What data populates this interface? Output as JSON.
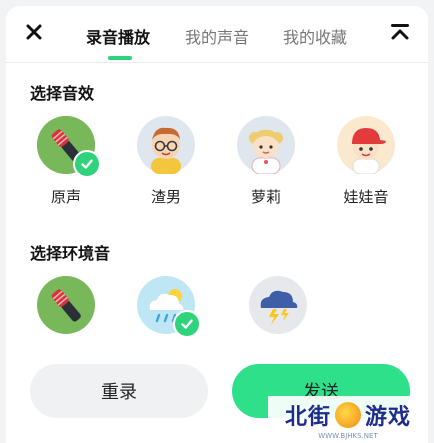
{
  "tabs": [
    "录音播放",
    "我的声音",
    "我的收藏"
  ],
  "active_tab": 0,
  "sections": {
    "effects_title": "选择音效",
    "ambient_title": "选择环境音"
  },
  "effects": [
    {
      "label": "原声",
      "icon": "microphone-icon",
      "selected": true
    },
    {
      "label": "渣男",
      "icon": "glasses-boy-icon",
      "selected": false
    },
    {
      "label": "萝莉",
      "icon": "girl-icon",
      "selected": false
    },
    {
      "label": "娃娃音",
      "icon": "cap-kid-icon",
      "selected": false
    }
  ],
  "ambient": [
    {
      "icon": "microphone-icon",
      "selected": false
    },
    {
      "icon": "rain-cloud-icon",
      "selected": true
    },
    {
      "icon": "thunderstorm-icon",
      "selected": false
    }
  ],
  "buttons": {
    "reset": "重录",
    "send": "发送"
  },
  "watermark": {
    "text_left": "北街",
    "text_right": "游戏",
    "url": "WWW.BJHKS.NET"
  },
  "colors": {
    "accent": "#2fd37b",
    "send": "#2ee08a"
  }
}
